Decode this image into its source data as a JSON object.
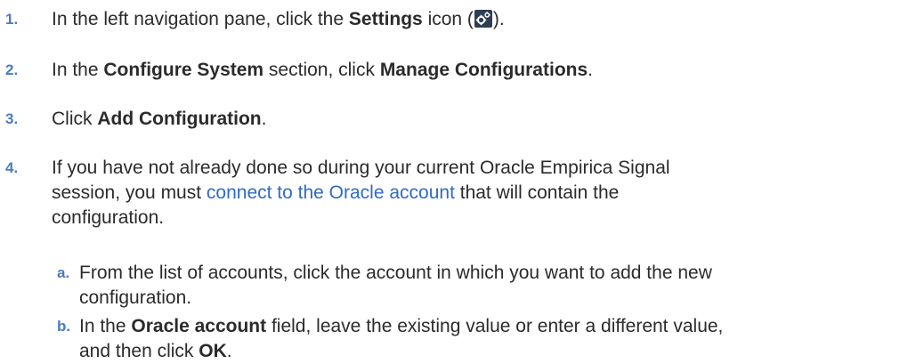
{
  "steps": [
    {
      "num": "1.",
      "pre": "In the left navigation pane, click the ",
      "bold": "Settings",
      "post": " icon (",
      "end": ")."
    },
    {
      "num": "2.",
      "pre": "In the ",
      "bold1": "Configure System",
      "mid": " section, click ",
      "bold2": "Manage Configurations",
      "end": "."
    },
    {
      "num": "3.",
      "pre": "Click ",
      "bold": "Add Configuration",
      "end": "."
    },
    {
      "num": "4.",
      "line1": "If you have not already done so during your current Oracle Empirica Signal",
      "line2_pre": "session, you must ",
      "link": "connect to the Oracle account",
      "line2_post": " that will contain the",
      "line3": "configuration."
    }
  ],
  "substeps": [
    {
      "num": "a.",
      "line1": "From the list of accounts, click the account in which you want to add the new",
      "line2": "configuration."
    },
    {
      "num": "b.",
      "pre": "In the ",
      "bold1": "Oracle account",
      "mid": " field, leave the existing value or enter a different value,",
      "line2_pre": "and then click ",
      "bold2": "OK",
      "end": "."
    }
  ],
  "icons": {
    "settings": "settings-gear-icon"
  },
  "colors": {
    "step_number": "#4a7cbf",
    "link": "#2f6ac8",
    "text": "#2b2b2b"
  }
}
